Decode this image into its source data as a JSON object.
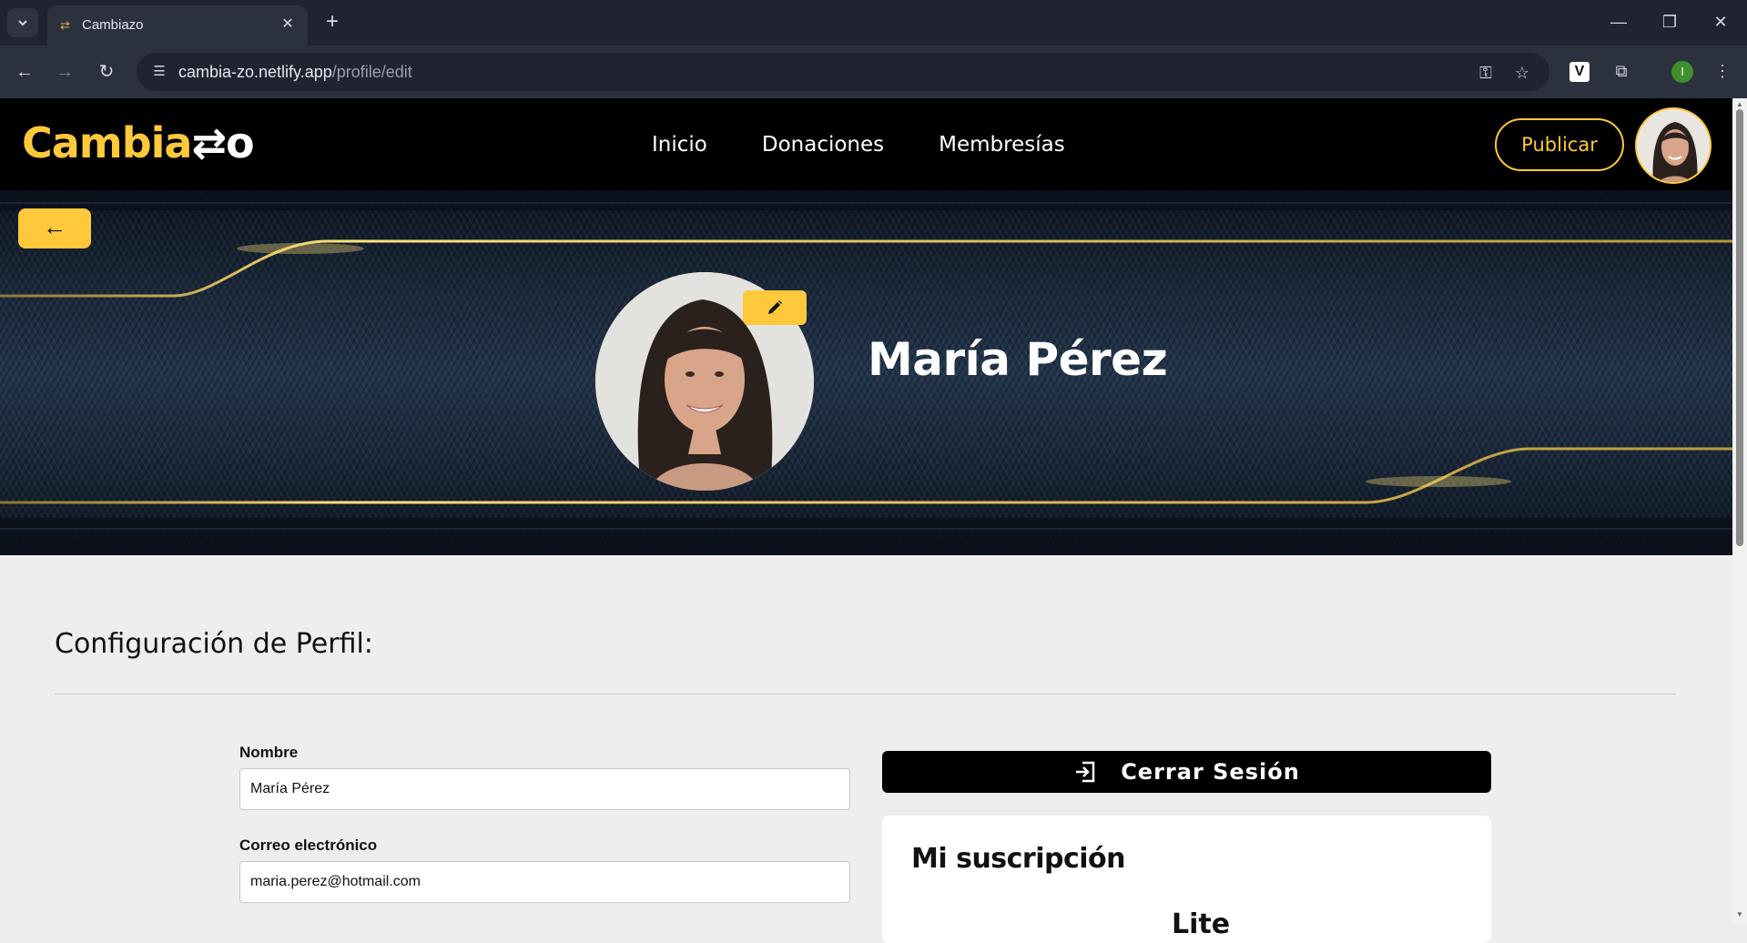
{
  "browser": {
    "tab_title": "Cambiazo",
    "url_host": "cambia-zo.netlify.app",
    "url_path": "/profile/edit",
    "profile_initial": "I"
  },
  "header": {
    "logo_part1": "Cambia",
    "logo_part2": "⇄o",
    "nav": [
      "Inicio",
      "Donaciones",
      "Membresías"
    ],
    "publish_label": "Publicar"
  },
  "banner": {
    "back_symbol": "←",
    "user_name": "María Pérez"
  },
  "profile_settings": {
    "title": "Configuración de Perfil:",
    "fields": [
      {
        "label": "Nombre",
        "value": "María Pérez"
      },
      {
        "label": "Correo electrónico",
        "value": "maria.perez@hotmail.com"
      }
    ]
  },
  "actions": {
    "logout_label": "Cerrar Sesión"
  },
  "subscription": {
    "title": "Mi suscripción",
    "plan": "Lite"
  },
  "colors": {
    "accent": "#ffc93b",
    "header_bg": "#000000",
    "page_bg": "#eeeeee"
  }
}
